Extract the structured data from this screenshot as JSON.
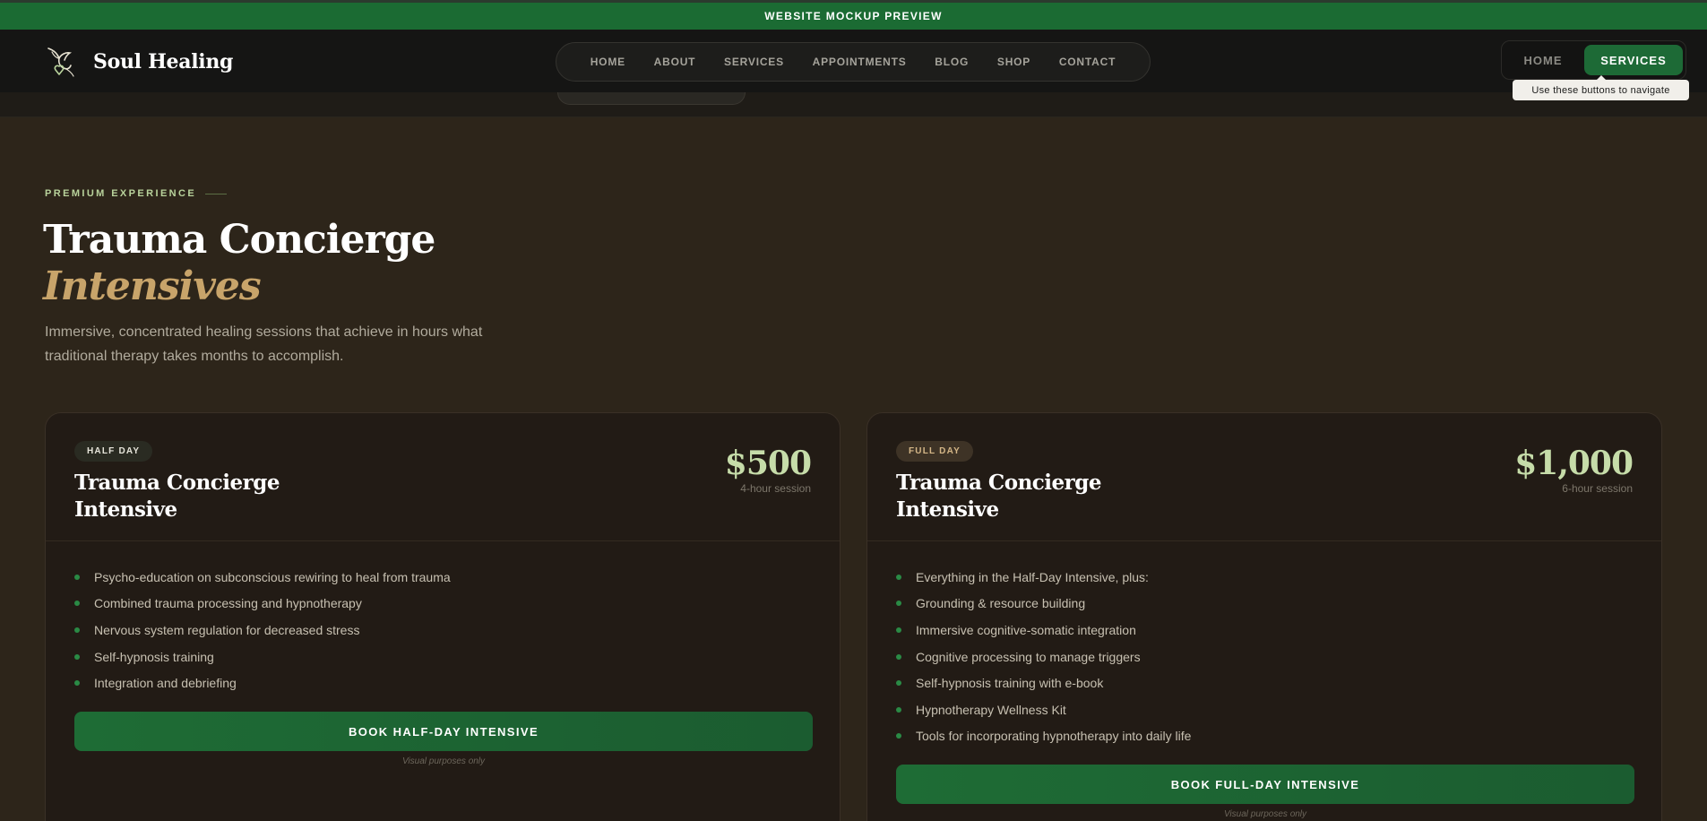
{
  "preview_banner": "WEBSITE MOCKUP PREVIEW",
  "brand": {
    "name": "Soul Healing",
    "logo_icon": "hummingbird-heart-icon"
  },
  "nav": {
    "items": [
      "HOME",
      "ABOUT",
      "SERVICES",
      "APPOINTMENTS",
      "BLOG",
      "SHOP",
      "CONTACT"
    ]
  },
  "page_switch": {
    "home_label": "HOME",
    "services_label": "SERVICES",
    "tooltip": "Use these buttons to navigate"
  },
  "hero": {
    "eyebrow": "PREMIUM EXPERIENCE",
    "title": "Trauma Concierge",
    "title_accent": "Intensives",
    "description": "Immersive, concentrated healing sessions that achieve in hours what traditional therapy takes months to accomplish."
  },
  "cards": [
    {
      "badge": "HALF DAY",
      "title_line1": "Trauma Concierge",
      "title_line2": "Intensive",
      "price": "$500",
      "duration": "4-hour session",
      "features": [
        "Psycho-education on subconscious rewiring to heal from trauma",
        "Combined trauma processing and hypnotherapy",
        "Nervous system regulation for decreased stress",
        "Self-hypnosis training",
        "Integration and debriefing"
      ],
      "button": "BOOK HALF-DAY INTENSIVE",
      "note": "Visual purposes only"
    },
    {
      "badge": "FULL DAY",
      "title_line1": "Trauma Concierge",
      "title_line2": "Intensive",
      "price": "$1,000",
      "duration": "6-hour session",
      "features": [
        "Everything in the Half-Day Intensive, plus:",
        "Grounding & resource building",
        "Immersive cognitive-somatic integration",
        "Cognitive processing to manage triggers",
        "Self-hypnosis training with e-book",
        "Hypnotherapy Wellness Kit",
        "Tools for incorporating hypnotherapy into daily life"
      ],
      "button": "BOOK FULL-DAY INTENSIVE",
      "note": "Visual purposes only"
    }
  ],
  "colors": {
    "brand_green": "#1d6a36",
    "accent_gold": "#c8a46a",
    "price_green": "#c6dca9",
    "background": "#2d251a"
  }
}
